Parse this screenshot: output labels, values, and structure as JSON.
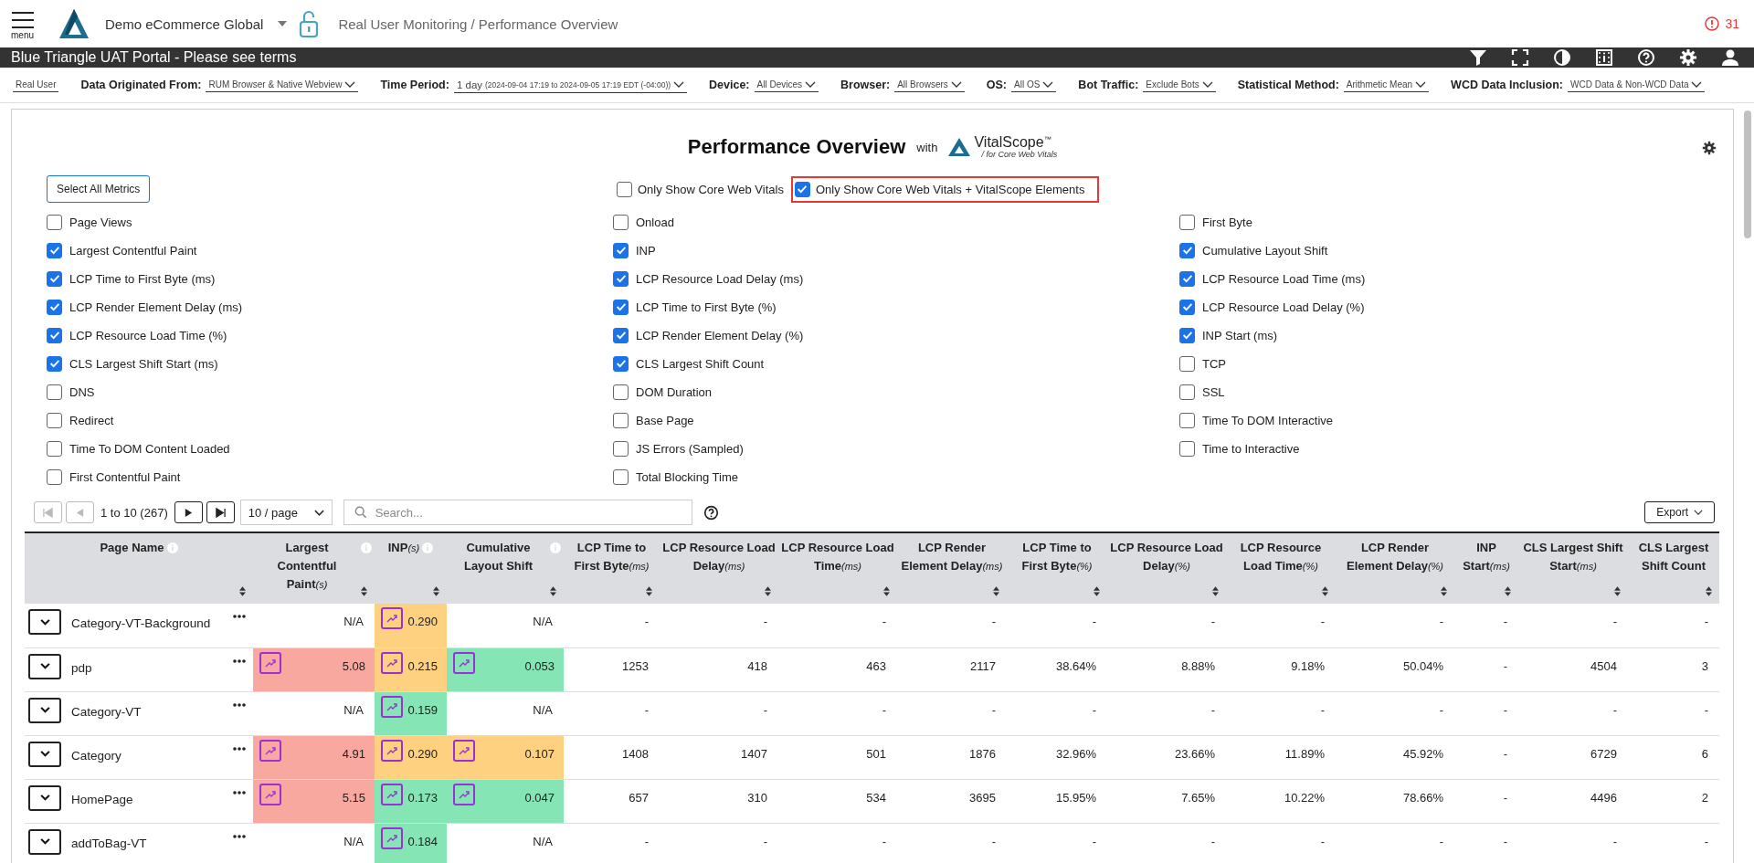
{
  "header": {
    "menu_label": "menu",
    "account": "Demo eCommerce Global",
    "breadcrumb": "Real User Monitoring / Performance Overview",
    "alert_count": "31"
  },
  "banner": {
    "title": "Blue Triangle UAT Portal - Please see terms"
  },
  "filters": [
    {
      "kind": "field",
      "value": "Real User"
    },
    {
      "kind": "dropdown",
      "label": "Data Originated From:",
      "value": "RUM Browser & Native Webview"
    },
    {
      "kind": "dropdown",
      "label": "Time Period:",
      "value": "1 day",
      "detail": "(2024-09-04 17:19 to 2024-09-05 17:19 EDT (-04:00))"
    },
    {
      "kind": "dropdown",
      "label": "Device:",
      "value": "All Devices"
    },
    {
      "kind": "dropdown",
      "label": "Browser:",
      "value": "All Browsers"
    },
    {
      "kind": "dropdown",
      "label": "OS:",
      "value": "All OS"
    },
    {
      "kind": "dropdown",
      "label": "Bot Traffic:",
      "value": "Exclude Bots"
    },
    {
      "kind": "dropdown",
      "label": "Statistical Method:",
      "value": "Arithmetic Mean"
    },
    {
      "kind": "dropdown",
      "label": "WCD Data Inclusion:",
      "value": "WCD Data & Non-WCD Data"
    }
  ],
  "panel": {
    "title": "Performance Overview",
    "with": "with",
    "logo_name": "VitalScope",
    "logo_mark": "™",
    "logo_tagline": "/ for Core Web Vitals"
  },
  "select_all": "Select All Metrics",
  "presets": [
    {
      "label": "Only Show Core Web Vitals",
      "checked": false,
      "highlighted": false
    },
    {
      "label": "Only Show Core Web Vitals + VitalScope Elements",
      "checked": true,
      "highlighted": true
    }
  ],
  "metrics": [
    {
      "label": "Page Views",
      "checked": false
    },
    {
      "label": "Onload",
      "checked": false
    },
    {
      "label": "First Byte",
      "checked": false
    },
    {
      "label": "Largest Contentful Paint",
      "checked": true
    },
    {
      "label": "INP",
      "checked": true
    },
    {
      "label": "Cumulative Layout Shift",
      "checked": true
    },
    {
      "label": "LCP Time to First Byte (ms)",
      "checked": true
    },
    {
      "label": "LCP Resource Load Delay (ms)",
      "checked": true
    },
    {
      "label": "LCP Resource Load Time (ms)",
      "checked": true
    },
    {
      "label": "LCP Render Element Delay (ms)",
      "checked": true
    },
    {
      "label": "LCP Time to First Byte (%)",
      "checked": true
    },
    {
      "label": "LCP Resource Load Delay (%)",
      "checked": true
    },
    {
      "label": "LCP Resource Load Time (%)",
      "checked": true
    },
    {
      "label": "LCP Render Element Delay (%)",
      "checked": true
    },
    {
      "label": "INP Start (ms)",
      "checked": true
    },
    {
      "label": "CLS Largest Shift Start (ms)",
      "checked": true
    },
    {
      "label": "CLS Largest Shift Count",
      "checked": true
    },
    {
      "label": "TCP",
      "checked": false
    },
    {
      "label": "DNS",
      "checked": false
    },
    {
      "label": "DOM Duration",
      "checked": false
    },
    {
      "label": "SSL",
      "checked": false
    },
    {
      "label": "Redirect",
      "checked": false
    },
    {
      "label": "Base Page",
      "checked": false
    },
    {
      "label": "Time To DOM Interactive",
      "checked": false
    },
    {
      "label": "Time To DOM Content Loaded",
      "checked": false
    },
    {
      "label": "JS Errors (Sampled)",
      "checked": false
    },
    {
      "label": "Time to Interactive",
      "checked": false
    },
    {
      "label": "First Contentful Paint",
      "checked": false
    },
    {
      "label": "Total Blocking Time",
      "checked": false
    }
  ],
  "pager": {
    "first_disabled": true,
    "prev_disabled": true,
    "range": "1 to 10 (267)",
    "page_size": "10 / page",
    "search_placeholder": "Search...",
    "export": "Export"
  },
  "table": {
    "columns": [
      {
        "name": "Page Name",
        "info": true
      },
      {
        "name": "Largest Contentful Paint",
        "unit": "(s)",
        "info": true
      },
      {
        "name": "INP",
        "unit": "(s)",
        "info": true
      },
      {
        "name": "Cumulative Layout Shift",
        "info": true
      },
      {
        "name": "LCP Time to First Byte",
        "unit": "(ms)",
        "info": false
      },
      {
        "name": "LCP Resource Load Delay",
        "unit": "(ms)",
        "info": false
      },
      {
        "name": "LCP Resource Load Time",
        "unit": "(ms)",
        "info": false
      },
      {
        "name": "LCP Render Element Delay",
        "unit": "(ms)",
        "info": false
      },
      {
        "name": "LCP Time to First Byte",
        "unit": "(%)",
        "info": false
      },
      {
        "name": "LCP Resource Load Delay",
        "unit": "(%)",
        "info": false
      },
      {
        "name": "LCP Resource Load Time",
        "unit": "(%)",
        "info": false
      },
      {
        "name": "LCP Render Element Delay",
        "unit": "(%)",
        "info": false
      },
      {
        "name": "INP Start",
        "unit": "(ms)",
        "info": false
      },
      {
        "name": "CLS Largest Shift Start",
        "unit": "(ms)",
        "info": false
      },
      {
        "name": "CLS Largest Shift Count",
        "info": false
      }
    ],
    "rows": [
      {
        "cells": [
          {
            "value": "Category-VT-Background"
          },
          {
            "value": "N/A"
          },
          {
            "value": "0.290",
            "color": "#fdd17f"
          },
          {
            "value": "N/A"
          },
          {
            "value": "-"
          },
          {
            "value": "-"
          },
          {
            "value": "-"
          },
          {
            "value": "-"
          },
          {
            "value": "-"
          },
          {
            "value": "-"
          },
          {
            "value": "-"
          },
          {
            "value": "-"
          },
          {
            "value": "-"
          },
          {
            "value": "-"
          },
          {
            "value": "-"
          }
        ]
      },
      {
        "cells": [
          {
            "value": "pdp"
          },
          {
            "value": "5.08",
            "color": "#f9a8a0"
          },
          {
            "value": "0.215",
            "color": "#fdd17f"
          },
          {
            "value": "0.053",
            "color": "#86e5b5"
          },
          {
            "value": "1253"
          },
          {
            "value": "418"
          },
          {
            "value": "463"
          },
          {
            "value": "2117"
          },
          {
            "value": "38.64%"
          },
          {
            "value": "8.88%"
          },
          {
            "value": "9.18%"
          },
          {
            "value": "50.04%"
          },
          {
            "value": "-"
          },
          {
            "value": "4504"
          },
          {
            "value": "3"
          }
        ]
      },
      {
        "cells": [
          {
            "value": "Category-VT"
          },
          {
            "value": "N/A"
          },
          {
            "value": "0.159",
            "color": "#86e5b5"
          },
          {
            "value": "N/A"
          },
          {
            "value": "-"
          },
          {
            "value": "-"
          },
          {
            "value": "-"
          },
          {
            "value": "-"
          },
          {
            "value": "-"
          },
          {
            "value": "-"
          },
          {
            "value": "-"
          },
          {
            "value": "-"
          },
          {
            "value": "-"
          },
          {
            "value": "-"
          },
          {
            "value": "-"
          }
        ]
      },
      {
        "cells": [
          {
            "value": "Category"
          },
          {
            "value": "4.91",
            "color": "#f9a8a0"
          },
          {
            "value": "0.290",
            "color": "#fdd17f"
          },
          {
            "value": "0.107",
            "color": "#fdd17f"
          },
          {
            "value": "1408"
          },
          {
            "value": "1407"
          },
          {
            "value": "501"
          },
          {
            "value": "1876"
          },
          {
            "value": "32.96%"
          },
          {
            "value": "23.66%"
          },
          {
            "value": "11.89%"
          },
          {
            "value": "45.92%"
          },
          {
            "value": "-"
          },
          {
            "value": "6729"
          },
          {
            "value": "6"
          }
        ]
      },
      {
        "cells": [
          {
            "value": "HomePage"
          },
          {
            "value": "5.15",
            "color": "#f9a8a0"
          },
          {
            "value": "0.173",
            "color": "#86e5b5"
          },
          {
            "value": "0.047",
            "color": "#86e5b5"
          },
          {
            "value": "657"
          },
          {
            "value": "310"
          },
          {
            "value": "534"
          },
          {
            "value": "3695"
          },
          {
            "value": "15.95%"
          },
          {
            "value": "7.65%"
          },
          {
            "value": "10.22%"
          },
          {
            "value": "78.66%"
          },
          {
            "value": "-"
          },
          {
            "value": "4496"
          },
          {
            "value": "2"
          }
        ]
      },
      {
        "cells": [
          {
            "value": "addToBag-VT"
          },
          {
            "value": "N/A"
          },
          {
            "value": "0.184",
            "color": "#86e5b5"
          },
          {
            "value": "N/A"
          },
          {
            "value": "-"
          },
          {
            "value": "-"
          },
          {
            "value": "-"
          },
          {
            "value": "-"
          },
          {
            "value": "-"
          },
          {
            "value": "-"
          },
          {
            "value": "-"
          },
          {
            "value": "-"
          },
          {
            "value": "-"
          },
          {
            "value": "-"
          },
          {
            "value": "-"
          }
        ]
      }
    ]
  }
}
